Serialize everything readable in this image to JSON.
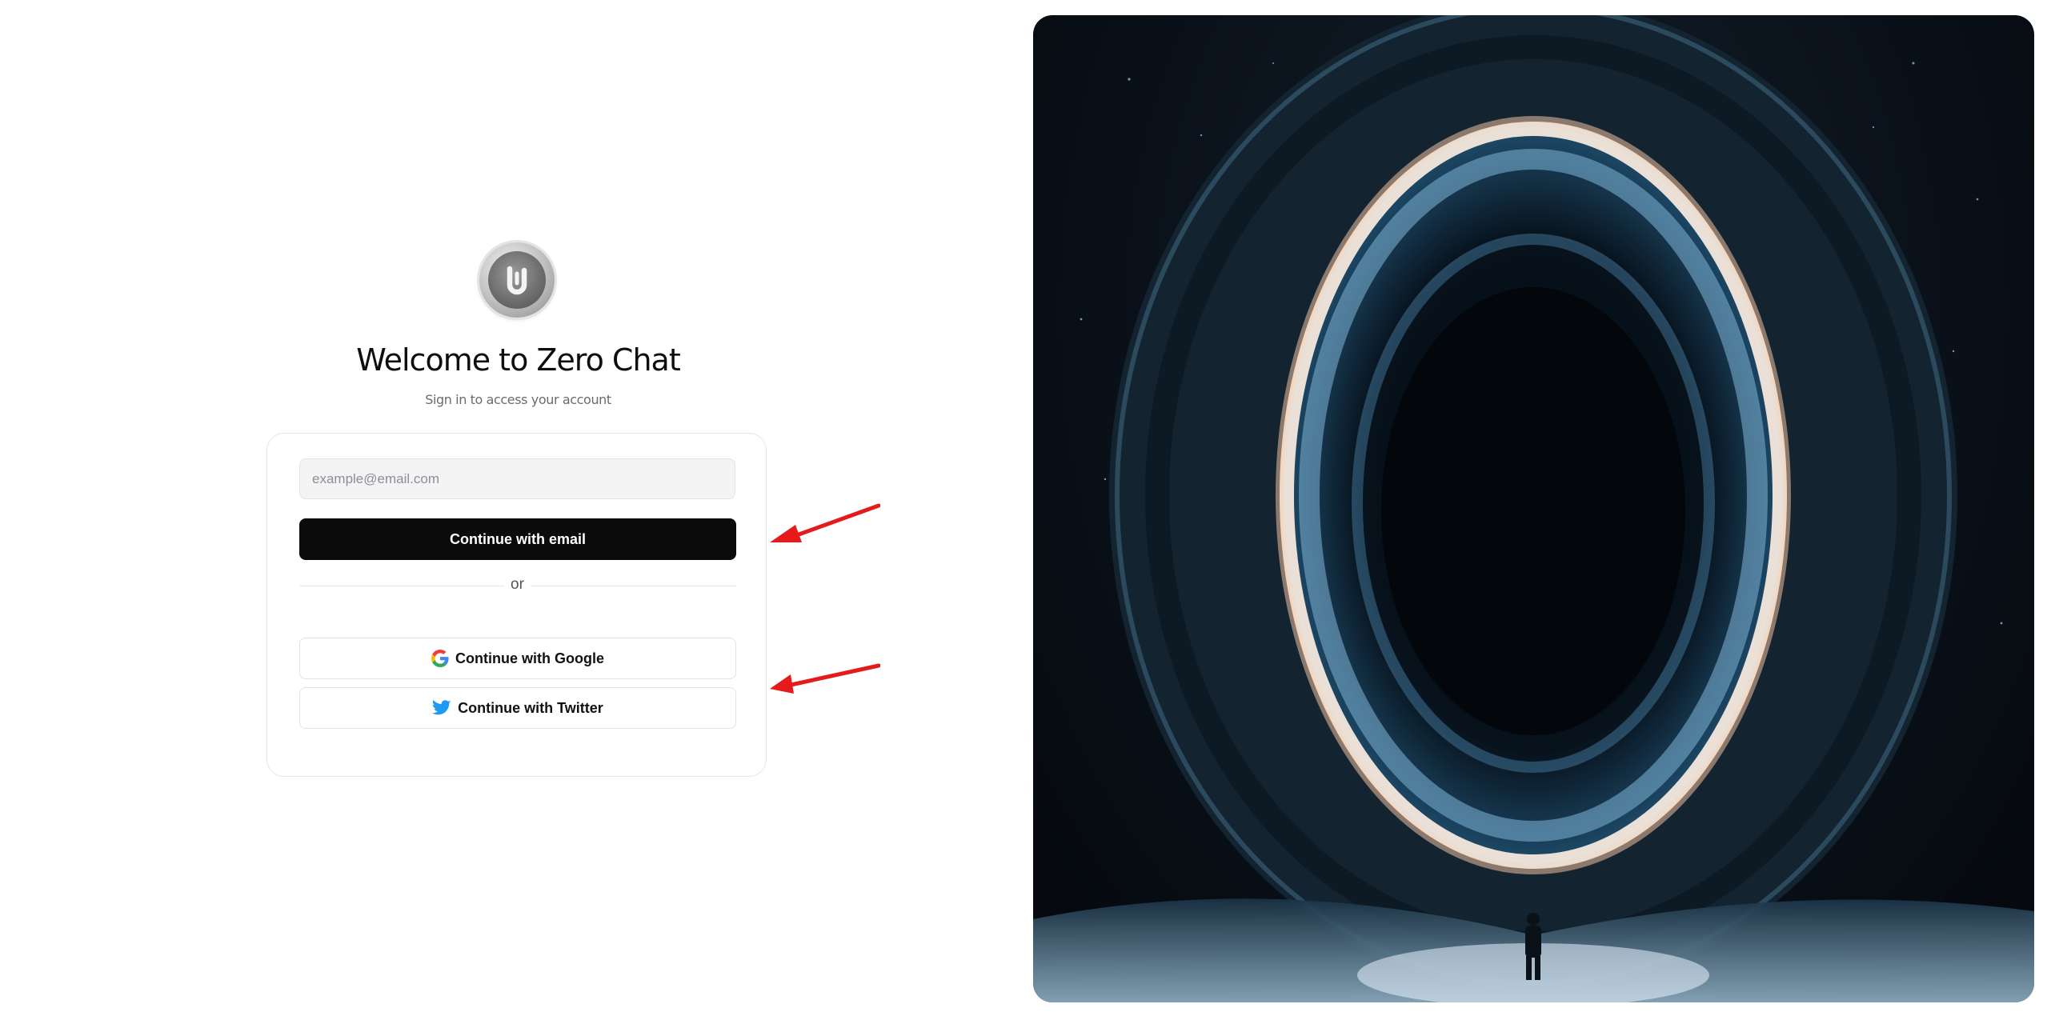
{
  "app": {
    "title": "Welcome to Zero Chat",
    "subtitle": "Sign in to access your account",
    "logo_icon": "zero-chat-logo"
  },
  "form": {
    "email_placeholder": "example@email.com",
    "email_value": "",
    "continue_email_label": "Continue with email",
    "divider_label": "or",
    "google_label": "Continue with Google",
    "twitter_label": "Continue with Twitter"
  },
  "icons": {
    "google": "google-icon",
    "twitter": "twitter-bird-icon"
  },
  "colors": {
    "primary_button": "#0b0b0c",
    "twitter_blue": "#1d9bf0",
    "annotation_red": "#e51b1b"
  }
}
